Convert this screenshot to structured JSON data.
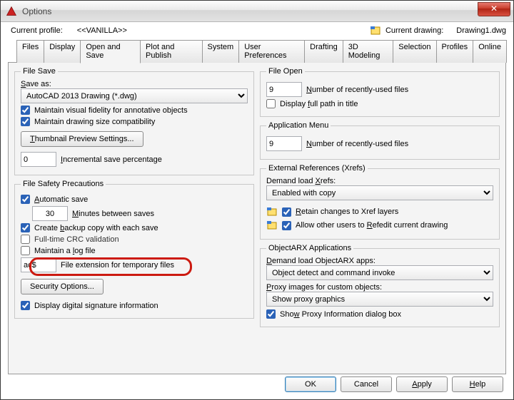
{
  "window": {
    "title": "Options"
  },
  "topbar": {
    "profile_label": "Current profile:",
    "profile_value": "<<VANILLA>>",
    "drawing_label": "Current drawing:",
    "drawing_value": "Drawing1.dwg"
  },
  "tabs": [
    "Files",
    "Display",
    "Open and Save",
    "Plot and Publish",
    "System",
    "User Preferences",
    "Drafting",
    "3D Modeling",
    "Selection",
    "Profiles",
    "Online"
  ],
  "active_tab": "Open and Save",
  "left": {
    "file_save_legend": "File Save",
    "save_as_label": "Save as:",
    "save_as_value": "AutoCAD 2013 Drawing (*.dwg)",
    "maintain_visual": "Maintain visual fidelity for annotative objects",
    "maintain_size": "Maintain drawing size compatibility",
    "thumbnail_btn": "Thumbnail Preview Settings...",
    "incremental_value": "0",
    "incremental_label": "Incremental save percentage",
    "safety_legend": "File Safety Precautions",
    "auto_save": "Automatic save",
    "minutes_value": "30",
    "minutes_label": "Minutes between saves",
    "backup": "Create backup copy with each save",
    "crc": "Full-time CRC validation",
    "logfile": "Maintain a log file",
    "ext_value": "ac$",
    "ext_label": "File extension for temporary files",
    "security_btn": "Security Options...",
    "digsig": "Display digital signature information"
  },
  "right": {
    "file_open_legend": "File Open",
    "recent1_value": "9",
    "recent1_label": "Number of recently-used files",
    "fullpath": "Display full path in title",
    "appmenu_legend": "Application Menu",
    "recent2_value": "9",
    "recent2_label": "Number of recently-used files",
    "xrefs_legend": "External References (Xrefs)",
    "demand_xrefs_label": "Demand load Xrefs:",
    "demand_xrefs_value": "Enabled with copy",
    "retain": "Retain changes to Xref layers",
    "allow_refedit": "Allow other users to Refedit current drawing",
    "arx_legend": "ObjectARX Applications",
    "demand_arx_label": "Demand load ObjectARX apps:",
    "demand_arx_value": "Object detect and command invoke",
    "proxy_label": "Proxy images for custom objects:",
    "proxy_value": "Show proxy graphics",
    "show_proxy_dlg": "Show Proxy Information dialog box"
  },
  "buttons": {
    "ok": "OK",
    "cancel": "Cancel",
    "apply": "Apply",
    "help": "Help"
  }
}
